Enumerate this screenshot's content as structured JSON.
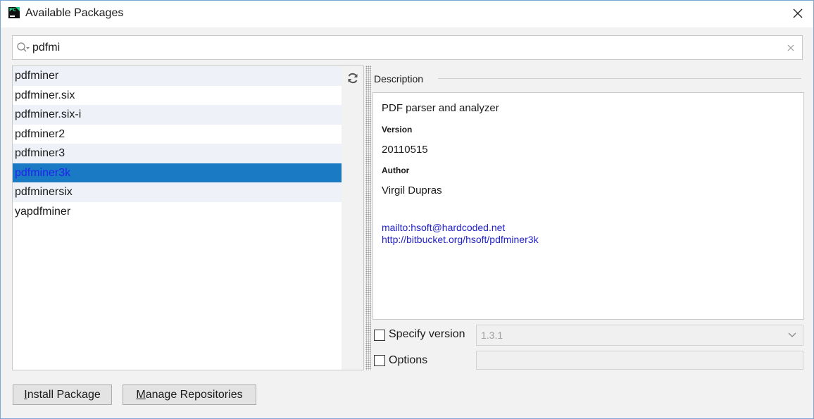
{
  "window": {
    "title": "Available Packages"
  },
  "search": {
    "value": "pdfmi",
    "icon": "search-icon"
  },
  "packages": [
    {
      "name": "pdfminer"
    },
    {
      "name": "pdfminer.six"
    },
    {
      "name": "pdfminer.six-i"
    },
    {
      "name": "pdfminer2"
    },
    {
      "name": "pdfminer3"
    },
    {
      "name": "pdfminer3k",
      "selected": true
    },
    {
      "name": "pdfminersix"
    },
    {
      "name": "yapdfminer"
    }
  ],
  "description": {
    "header": "Description",
    "summary": "PDF parser and analyzer",
    "version_label": "Version",
    "version_value": "20110515",
    "author_label": "Author",
    "author_value": "Virgil Dupras",
    "email_link": "mailto:hsoft@hardcoded.net",
    "home_link": "http://bitbucket.org/hsoft/pdfminer3k"
  },
  "options": {
    "specify_version_label": "Specify version",
    "specify_version_checked": false,
    "version_selected": "1.3.1",
    "options_label": "Options",
    "options_checked": false,
    "options_value": ""
  },
  "buttons": {
    "install_mnemonic": "I",
    "install_rest": "nstall Package",
    "manage_mnemonic": "M",
    "manage_rest": "anage Repositories"
  },
  "colors": {
    "selection": "#1a7ac4",
    "selected_text": "#2222ee",
    "link": "#2323c8",
    "alt_row": "#eef2f8"
  }
}
